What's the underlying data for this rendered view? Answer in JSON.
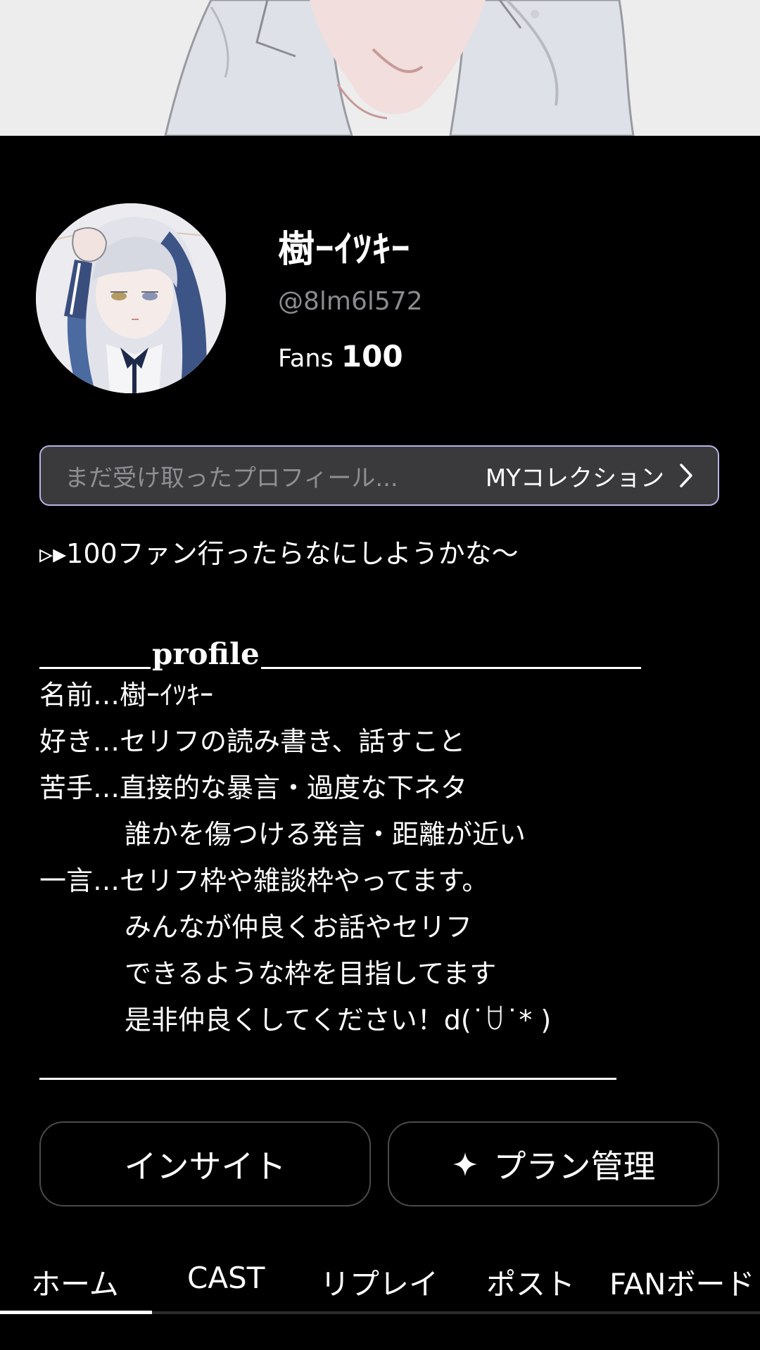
{
  "profile": {
    "display_name": "樹ｰｲﾂｷｰ",
    "handle": "@8lm6l572",
    "fans_label": "Fans",
    "fans_count": "100"
  },
  "collection": {
    "placeholder": "まだ受け取ったプロフィール...",
    "link_label": "MYコレクション"
  },
  "bio": {
    "intro": "▹▸100ファン行ったらなにしようかな～",
    "section_title": "profile",
    "lines": [
      "名前…樹ｰｲﾂｷｰ",
      "好き…セリフの読み書き、話すこと",
      "苦手…直接的な暴言・過度な下ネタ",
      "誰かを傷つける発言・距離が近い",
      "一言…セリフ枠や雑談枠やってます。",
      "みんなが仲良くお話やセリフ",
      "できるような枠を目指してます",
      "是非仲良くしてください！d(˙ꇴ˙* )"
    ]
  },
  "actions": {
    "insight_label": "インサイト",
    "plan_label": "プラン管理"
  },
  "tabs": [
    {
      "label": "ホーム",
      "active": true
    },
    {
      "label": "CAST",
      "active": false
    },
    {
      "label": "リプレイ",
      "active": false
    },
    {
      "label": "ポスト",
      "active": false
    },
    {
      "label": "FANボード",
      "active": false
    }
  ],
  "icons": {
    "collection_arrow": "chevron-right-icon",
    "plan": "sparkle-icon"
  },
  "colors": {
    "background": "#000000",
    "collection_border": "#b8b4e6",
    "collection_fill": "#3a3a3c",
    "muted_text": "#8a8a8f"
  }
}
